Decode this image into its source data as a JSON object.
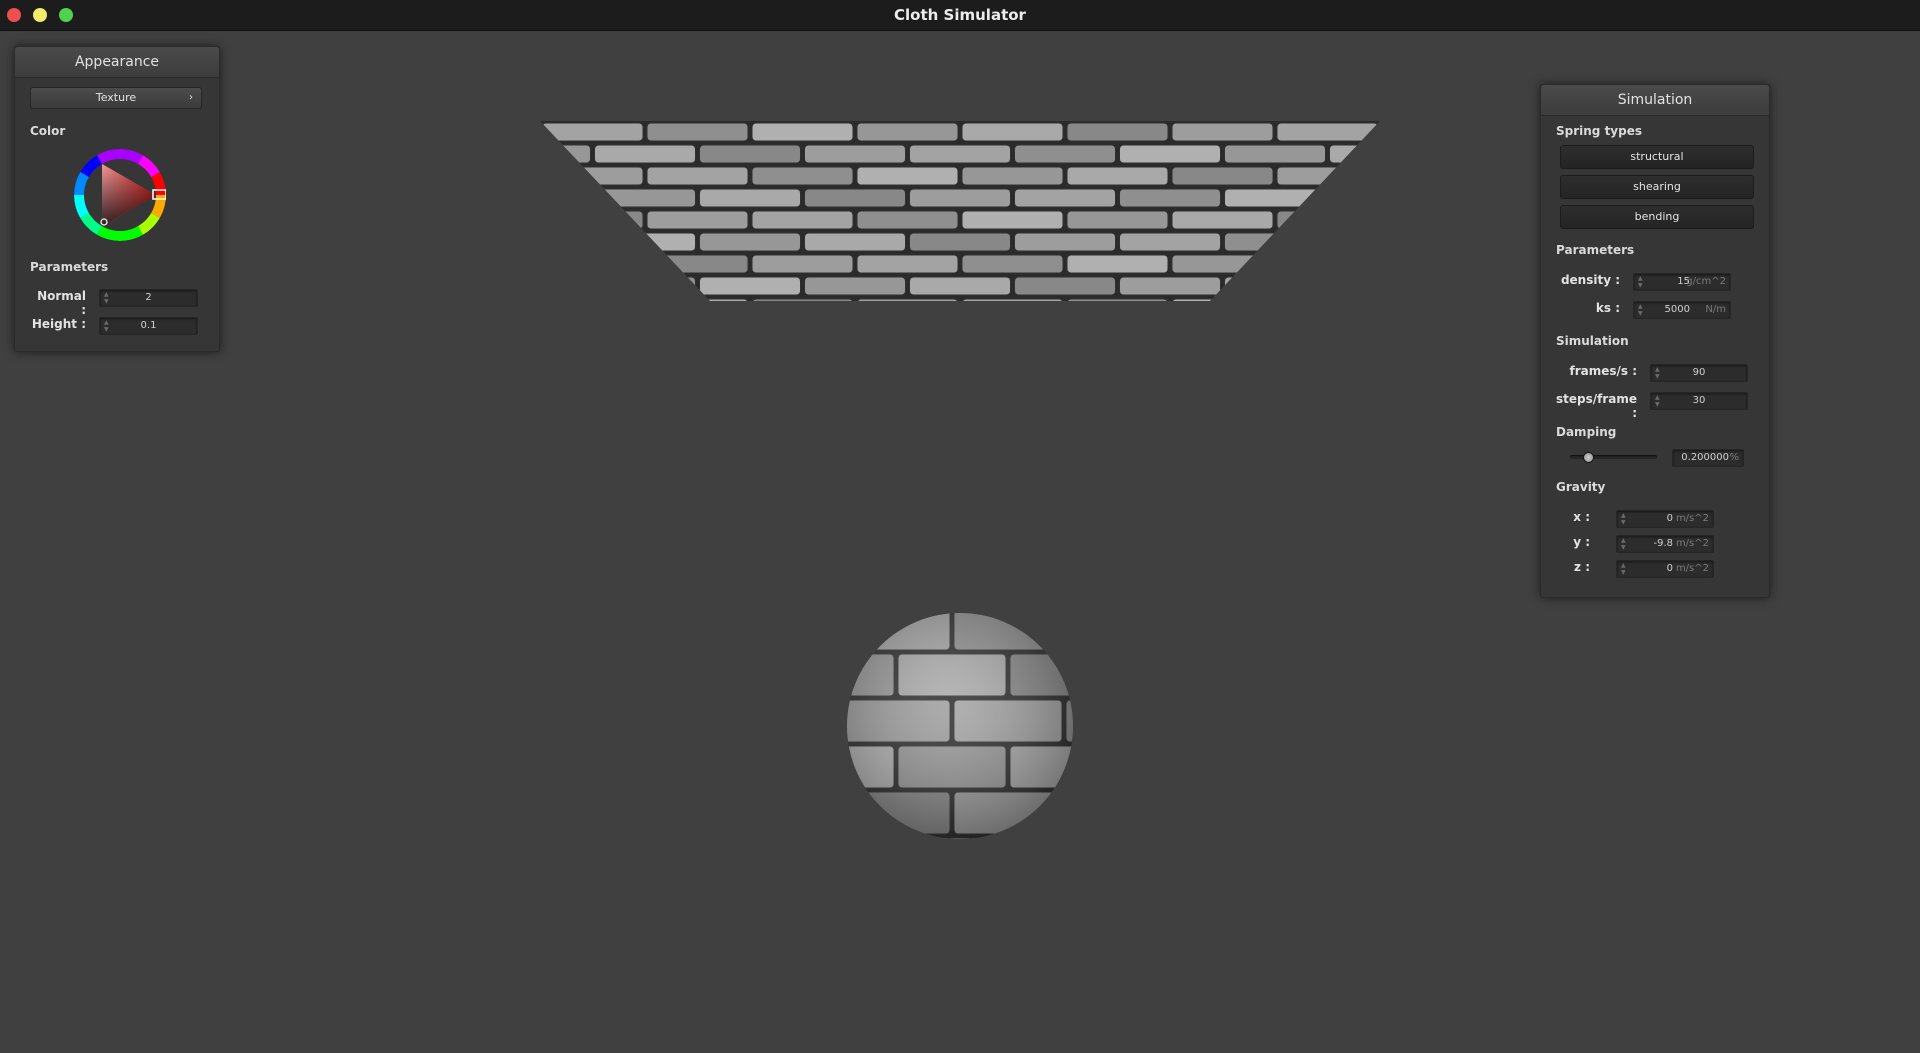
{
  "window": {
    "title": "Cloth Simulator"
  },
  "appearance": {
    "title": "Appearance",
    "texture_label": "Texture",
    "color_label": "Color",
    "parameters_label": "Parameters",
    "normal": {
      "label": "Normal :",
      "value": "2"
    },
    "height": {
      "label": "Height :",
      "value": "0.1"
    }
  },
  "simulation": {
    "title": "Simulation",
    "spring_types_label": "Spring types",
    "springs": [
      "structural",
      "shearing",
      "bending"
    ],
    "parameters_label": "Parameters",
    "density": {
      "label": "density :",
      "value": "15",
      "unit": "g/cm^2"
    },
    "ks": {
      "label": "ks :",
      "value": "5000",
      "unit": "N/m"
    },
    "simulation_label": "Simulation",
    "fps": {
      "label": "frames/s :",
      "value": "90"
    },
    "steps": {
      "label": "steps/frame :",
      "value": "30"
    },
    "damping_label": "Damping",
    "damping": {
      "value": "0.200000",
      "unit": "%",
      "slider_fraction": 0.2
    },
    "gravity_label": "Gravity",
    "gravity": {
      "x": {
        "label": "x :",
        "value": "0",
        "unit": "m/s^2"
      },
      "y": {
        "label": "y :",
        "value": "-9.8",
        "unit": "m/s^2"
      },
      "z": {
        "label": "z :",
        "value": "0",
        "unit": "m/s^2"
      }
    }
  },
  "scene": {
    "texture": "brick",
    "cloth_shape": "trapezoid-plane",
    "obstacle": "sphere"
  },
  "colors": {
    "background": "#404040",
    "titlebar": "#1c1c1c",
    "panel": "#363636",
    "selected_hue": "#e02020"
  }
}
